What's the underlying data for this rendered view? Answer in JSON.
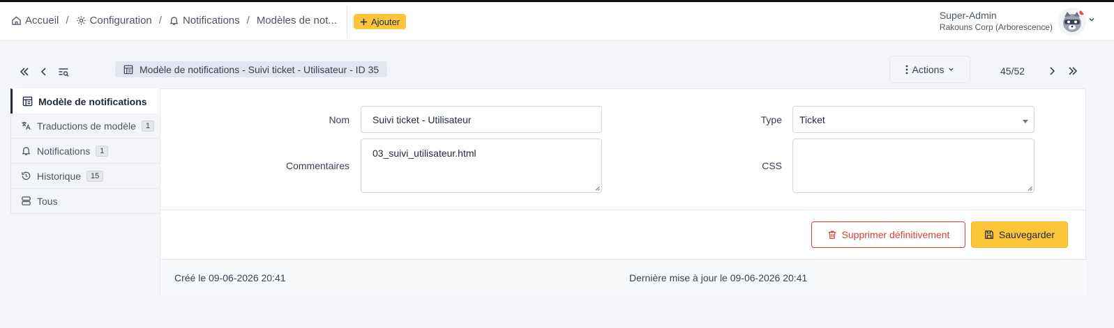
{
  "breadcrumb": {
    "items": [
      {
        "label": "Accueil",
        "icon": "home-icon"
      },
      {
        "label": "Configuration",
        "icon": "gear-icon"
      },
      {
        "label": "Notifications",
        "icon": "bell-icon"
      },
      {
        "label": "Modèles de not..."
      }
    ],
    "separator": "/"
  },
  "header": {
    "add_label": "Ajouter",
    "user_name": "Super-Admin",
    "user_entity": "Rakouns Corp (Arborescence)"
  },
  "toolbar": {
    "title": "Modèle de notifications -  Suivi ticket - Utilisateur - ID 35",
    "actions_label": "Actions",
    "pager": "45/52"
  },
  "sidebar": {
    "items": [
      {
        "label": "Modèle de notifications",
        "icon": "template-icon",
        "badge": ""
      },
      {
        "label": "Traductions de modèle",
        "icon": "translate-icon",
        "badge": "1"
      },
      {
        "label": "Notifications",
        "icon": "bell-icon",
        "badge": "1"
      },
      {
        "label": "Historique",
        "icon": "history-icon",
        "badge": "15"
      },
      {
        "label": "Tous",
        "icon": "stack-icon",
        "badge": ""
      }
    ]
  },
  "form": {
    "name_label": "Nom",
    "name_value": "Suivi ticket - Utilisateur",
    "comment_label": "Commentaires",
    "comment_value": "03_suivi_utilisateur.html",
    "type_label": "Type",
    "type_value": "Ticket",
    "css_label": "CSS",
    "css_value": "",
    "delete_label": "Supprimer définitivement",
    "save_label": "Sauvegarder"
  },
  "footer": {
    "created": "Créé le 09-06-2026 20:41",
    "updated": "Dernière mise à jour le 09-06-2026 20:41"
  },
  "colors": {
    "accent": "#fcc53a",
    "danger": "#d43f3a",
    "background": "#f4f5f9"
  }
}
